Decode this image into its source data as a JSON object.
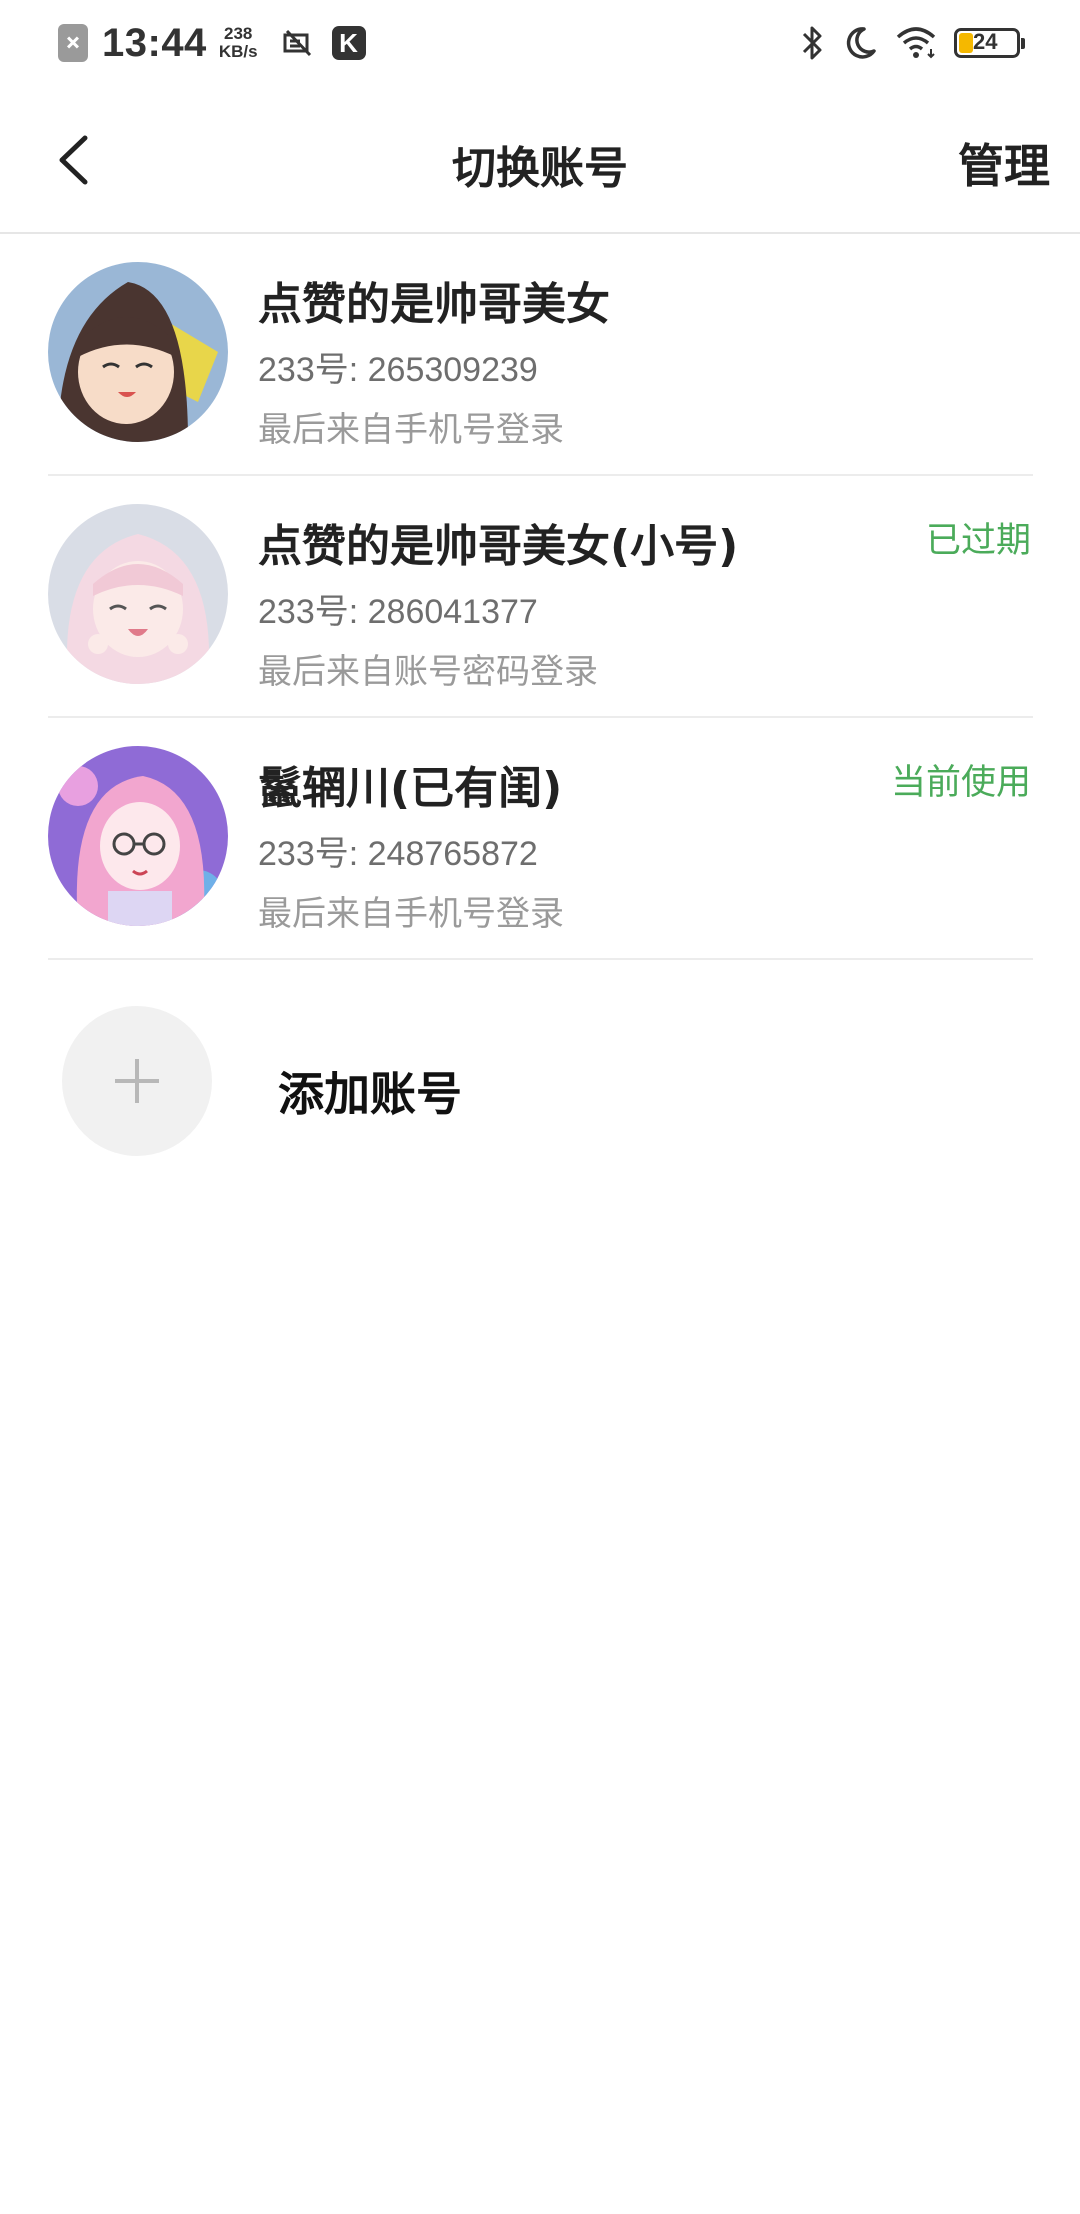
{
  "status_bar": {
    "time": "13:44",
    "speed_value": "238",
    "speed_unit": "KB/s",
    "battery": "24",
    "icons": [
      "notification-x-icon",
      "app-icon",
      "k-app-icon",
      "bluetooth-icon",
      "moon-icon",
      "wifi-icon",
      "battery-icon"
    ],
    "battery_color": "#f5b800"
  },
  "nav": {
    "title": "切换账号",
    "manage_label": "管理"
  },
  "accounts": [
    {
      "name": "点赞的是帅哥美女",
      "id_line": "233号: 265309239",
      "login_source": "最后来自手机号登录",
      "status": ""
    },
    {
      "name": "点赞的是帅哥美女(小号)",
      "id_line": "233号: 286041377",
      "login_source": "最后来自账号密码登录",
      "status": "已过期"
    },
    {
      "name": "鬣辋川(已有闺)",
      "id_line": "233号: 248765872",
      "login_source": "最后来自手机号登录",
      "status": "当前使用"
    }
  ],
  "add_account": {
    "label": "添加账号"
  },
  "colors": {
    "status_green": "#4bab5a",
    "divider": "#ececec"
  }
}
